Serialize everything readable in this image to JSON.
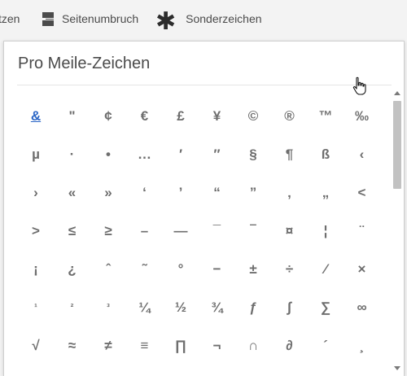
{
  "toolbar": {
    "items": [
      {
        "label": "tzen",
        "icon": "none"
      },
      {
        "label": "Seitenumbruch",
        "icon": "page-break-icon"
      },
      {
        "label": "Sonderzeichen",
        "icon": "asterisk-icon"
      }
    ]
  },
  "popover": {
    "title": "Pro Meile-Zeichen",
    "selected_index": 0,
    "characters": [
      "&",
      "\"",
      "¢",
      "€",
      "£",
      "¥",
      "©",
      "®",
      "™",
      "‰",
      "µ",
      "·",
      "•",
      "…",
      "′",
      "″",
      "§",
      "¶",
      "ß",
      "‹",
      "›",
      "«",
      "»",
      "‘",
      "’",
      "“",
      "”",
      "‚",
      "„",
      "<",
      ">",
      "≤",
      "≥",
      "–",
      "—",
      "¯",
      "‾",
      "¤",
      "¦",
      "¨",
      "¡",
      "¿",
      "ˆ",
      "˜",
      "°",
      "−",
      "±",
      "÷",
      "⁄",
      "×",
      "¹",
      "²",
      "³",
      "¼",
      "½",
      "¾",
      "ƒ",
      "∫",
      "∑",
      "∞",
      "√",
      "≈",
      "≠",
      "≡",
      "∏",
      "¬",
      "∩",
      "∂",
      "´",
      "¸"
    ]
  },
  "colors": {
    "accent": "#2b66c6",
    "text": "#4b4b4b",
    "glyph": "#6e6e6e"
  }
}
